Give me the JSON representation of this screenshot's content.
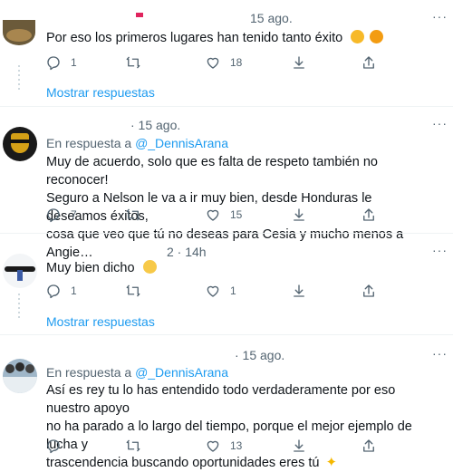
{
  "tweets": [
    {
      "time": "15 ago.",
      "text": "Por eso los primeros lugares han tenido tanto éxito",
      "counts": {
        "reply": "1",
        "retweet": "",
        "like": "18"
      }
    },
    {
      "time": "· 15 ago.",
      "reply_prefix": "En respuesta a",
      "reply_handle": "@_DennisArana",
      "lines": [
        "Muy de acuerdo, solo que es falta de respeto también no reconocer!",
        "Seguro a Nelson le va a ir muy bien, desde Honduras le deseamos éxitos,",
        "cosa que veo que tú no deseas para Cesia y mucho menos a Angie…"
      ],
      "counts": {
        "reply": "7",
        "retweet": "",
        "like": "15"
      }
    },
    {
      "time": "2 · 14h",
      "text": "Muy bien dicho",
      "counts": {
        "reply": "1",
        "retweet": "",
        "like": "1"
      }
    },
    {
      "time": "· 15 ago.",
      "reply_prefix": "En respuesta a",
      "reply_handle": "@_DennisArana",
      "lines": [
        "Así es rey tu lo has entendido todo verdaderamente por eso nuestro apoyo",
        "no ha parado a lo largo del tiempo, porque el mejor ejemplo de lucha y",
        "trascendencia buscando oportunidades eres tú"
      ],
      "counts": {
        "reply": "",
        "retweet": "",
        "like": "13"
      }
    }
  ],
  "show_more_label": "Mostrar respuestas",
  "more_label": "···",
  "colors": {
    "accent": "#1d9bf0",
    "muted": "#536471",
    "text": "#0f1419"
  }
}
